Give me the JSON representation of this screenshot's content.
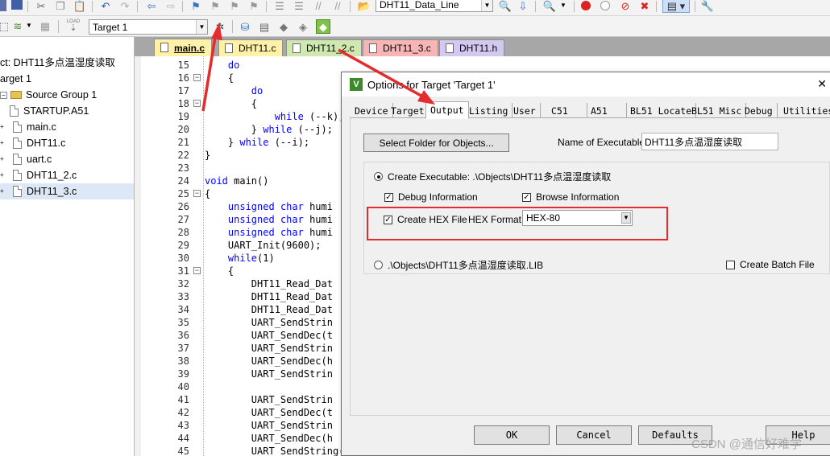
{
  "toolbar": {
    "target_label": "Target 1",
    "file_combo": "DHT11_Data_Line",
    "load_label": "LOAD"
  },
  "project": {
    "title": "ct: DHT11多点温湿度读取",
    "target": "arget 1",
    "group": "Source Group 1",
    "files": [
      "STARTUP.A51",
      "main.c",
      "DHT11.c",
      "uart.c",
      "DHT11_2.c",
      "DHT11_3.c"
    ]
  },
  "tabs": [
    {
      "label": "main.c",
      "color": "#fff1a8"
    },
    {
      "label": "DHT11.c",
      "color": "#fff1a8"
    },
    {
      "label": "DHT11_2.c",
      "color": "#cfe8b0"
    },
    {
      "label": "DHT11_3.c",
      "color": "#f7b5b5"
    },
    {
      "label": "DHT11.h",
      "color": "#d3c8f0"
    }
  ],
  "editor": {
    "line_numbers": [
      "15",
      "16",
      "17",
      "18",
      "19",
      "20",
      "21",
      "22",
      "23",
      "24",
      "25",
      "26",
      "27",
      "28",
      "29",
      "30",
      "31",
      "32",
      "33",
      "34",
      "35",
      "36",
      "37",
      "38",
      "39",
      "40",
      "41",
      "42",
      "43",
      "44",
      "45"
    ],
    "lines": [
      "    do",
      "    {",
      "        do",
      "        {",
      "            while (--k);",
      "        } while (--j);",
      "    } while (--i);",
      "}",
      "",
      "void main()",
      "{",
      "    unsigned char humi",
      "    unsigned char humi",
      "    unsigned char humi",
      "    UART_Init(9600);",
      "    while(1)",
      "    {",
      "        DHT11_Read_Dat",
      "        DHT11_Read_Dat",
      "        DHT11_Read_Dat",
      "        UART_SendStrin",
      "        UART_SendDec(t",
      "        UART_SendStrin",
      "        UART_SendDec(h",
      "        UART_SendStrin",
      "",
      "        UART_SendStrin",
      "        UART_SendDec(t",
      "        UART_SendStrin",
      "        UART_SendDec(h",
      "        UART_SendString(\"%\\r\\n\");"
    ]
  },
  "dialog": {
    "title": "Options for Target 'Target 1'",
    "tabs": [
      "Device",
      "Target",
      "Output",
      "Listing",
      "User",
      "C51",
      "A51",
      "BL51 Locate",
      "BL51 Misc",
      "Debug",
      "Utilities"
    ],
    "active_tab": "Output",
    "select_folder_button": "Select Folder for Objects...",
    "name_exec_label": "Name of Executable:",
    "name_exec_value": "DHT11多点温湿度读取",
    "create_exec_label": "Create Executable:  .\\Objects\\DHT11多点温湿度读取",
    "debug_info_label": "Debug Information",
    "browse_info_label": "Browse Information",
    "create_hex_label": "Create HEX File",
    "hex_format_label": "HEX Format:",
    "hex_format_value": "HEX-80",
    "lib_label": ".\\Objects\\DHT11多点温湿度读取.LIB",
    "batch_label": "Create Batch File",
    "ok": "OK",
    "cancel": "Cancel",
    "defaults": "Defaults",
    "help": "Help"
  },
  "watermark": "CSDN @通信好难学",
  "colors": {
    "annotation_red": "#e52c2c",
    "keyword_blue": "#0000ff"
  }
}
